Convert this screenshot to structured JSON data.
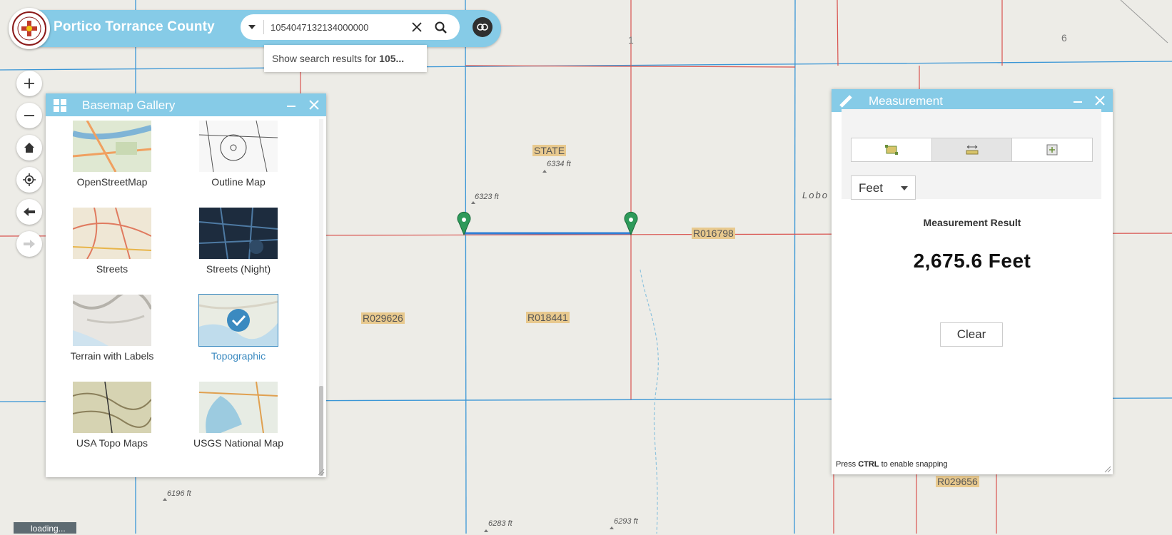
{
  "app": {
    "title": "Portico Torrance County",
    "logo_text": "TORRANCE COUNTY NEW MEXICO"
  },
  "search": {
    "value": "1054047132134000000",
    "suggestion_prefix": "Show search results for ",
    "suggestion_query": "105..."
  },
  "nav": {
    "zoom_in": "+",
    "zoom_out": "−"
  },
  "basemap_panel": {
    "title": "Basemap Gallery",
    "items": [
      {
        "label": "OpenStreetMap",
        "selected": false
      },
      {
        "label": "Outline Map",
        "selected": false
      },
      {
        "label": "Streets",
        "selected": false
      },
      {
        "label": "Streets (Night)",
        "selected": false
      },
      {
        "label": "Terrain with Labels",
        "selected": false
      },
      {
        "label": "Topographic",
        "selected": true
      },
      {
        "label": "USA Topo Maps",
        "selected": false
      },
      {
        "label": "USGS National Map",
        "selected": false
      }
    ]
  },
  "measurement_panel": {
    "title": "Measurement",
    "unit": "Feet",
    "result_label": "Measurement Result",
    "result_value": "2,675.6 Feet",
    "clear_label": "Clear",
    "snap_prefix": "Press ",
    "snap_key": "CTRL",
    "snap_suffix": " to enable snapping"
  },
  "map": {
    "labels": {
      "state": "STATE",
      "elev_6334": "6334 ft",
      "elev_6323": "6323 ft",
      "elev_6196": "6196 ft",
      "elev_6283": "6283 ft",
      "elev_6293": "6293 ft",
      "parcel_r016798": "R016798",
      "parcel_r029626": "R029626",
      "parcel_r018441": "R018441",
      "parcel_r029656": "R029656",
      "lobo": "Lobo",
      "section_1": "1",
      "section_6": "6"
    },
    "loading_text": "loading..."
  },
  "colors": {
    "header": "#86cbe7",
    "accent": "#3b8ac0",
    "measure_line": "#2f7fd6",
    "marker": "#2e9a5a"
  }
}
